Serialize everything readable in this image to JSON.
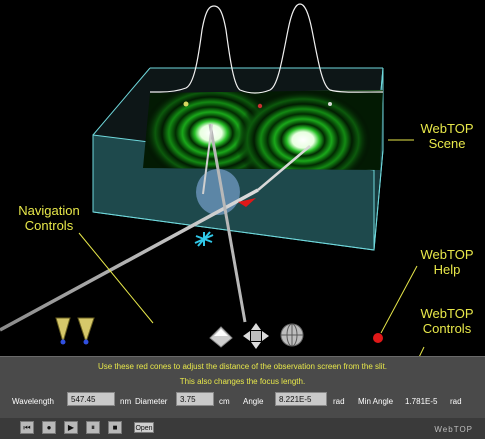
{
  "callouts": {
    "scene": [
      "WebTOP",
      "Scene"
    ],
    "navigation": [
      "Navigation",
      "Controls"
    ],
    "help": [
      "WebTOP",
      "Help"
    ],
    "controls": [
      "WebTOP",
      "Controls"
    ]
  },
  "help": {
    "line1": "Use these red cones to adjust the distance of the observation screen from the slit.",
    "line2": "This also changes the focus length."
  },
  "controls": {
    "wavelength": {
      "label": "Wavelength",
      "value": "547.45",
      "unit": "nm"
    },
    "diameter": {
      "label": "Diameter",
      "value": "3.75",
      "unit": "cm"
    },
    "angle": {
      "label": "Angle",
      "value": "8.221E-5",
      "unit": "rad"
    },
    "min_angle": {
      "label": "Min Angle",
      "value": "1.781E-5",
      "unit": "rad"
    }
  },
  "player": {
    "buttons": [
      "⏮",
      "●",
      "▶",
      "⏸",
      "■"
    ],
    "open_label": "Open"
  },
  "brand": "WebTOP",
  "colors": {
    "callout": "#e8e84a",
    "box_edge": "#5fd0d8",
    "fringe": "#2fd02f",
    "cone": "#d8c870",
    "panel": "#4a4a4a"
  }
}
